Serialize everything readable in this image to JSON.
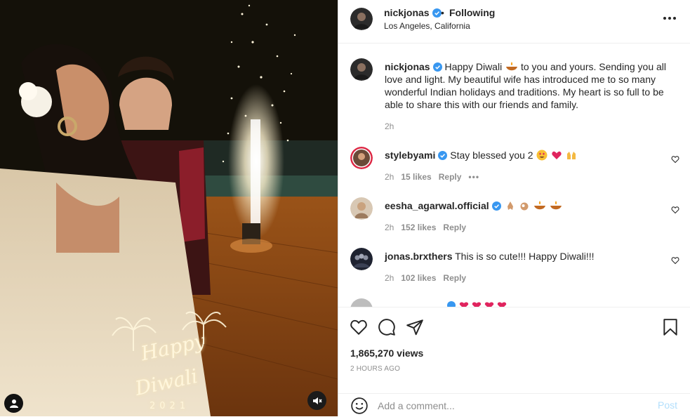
{
  "post": {
    "username": "nickjonas",
    "follow_status": "Following",
    "separator": "•",
    "location": "Los Angeles, California"
  },
  "media": {
    "overlay_happy": "Happy",
    "overlay_diwali": "Diwali",
    "overlay_year": "2021"
  },
  "caption": {
    "username": "nickjonas",
    "text_before_emoji": "Happy Diwali",
    "text_after_emoji": "to you and yours. Sending you all love and light. My beautiful wife has introduced me to so many wonderful Indian holidays and traditions. My heart is so full to be able to share this with our friends and family.",
    "time": "2h"
  },
  "comments": [
    {
      "username": "stylebyami",
      "text": "Stay blessed you 2",
      "time": "2h",
      "likes": "15 likes",
      "reply": "Reply",
      "more": "•••"
    },
    {
      "username": "eesha_agarwal.official",
      "text": "",
      "time": "2h",
      "likes": "152 likes",
      "reply": "Reply"
    },
    {
      "username": "jonas.brxthers",
      "text": "This is so cute!!! Happy Diwali!!!",
      "time": "2h",
      "likes": "102 likes",
      "reply": "Reply"
    }
  ],
  "stats": {
    "views": "1,865,270 views",
    "timestamp": "2 HOURS AGO"
  },
  "composer": {
    "placeholder": "Add a comment...",
    "post_label": "Post"
  },
  "colors": {
    "verified_blue": "#3897f0",
    "post_button": "#b2dffc",
    "secondary_text": "#8e8e8e"
  },
  "icons": [
    "verified-icon",
    "more-options-icon",
    "heart-icon",
    "comment-icon",
    "share-icon",
    "bookmark-icon",
    "emoji-icon",
    "user-tag-icon",
    "mute-icon"
  ]
}
